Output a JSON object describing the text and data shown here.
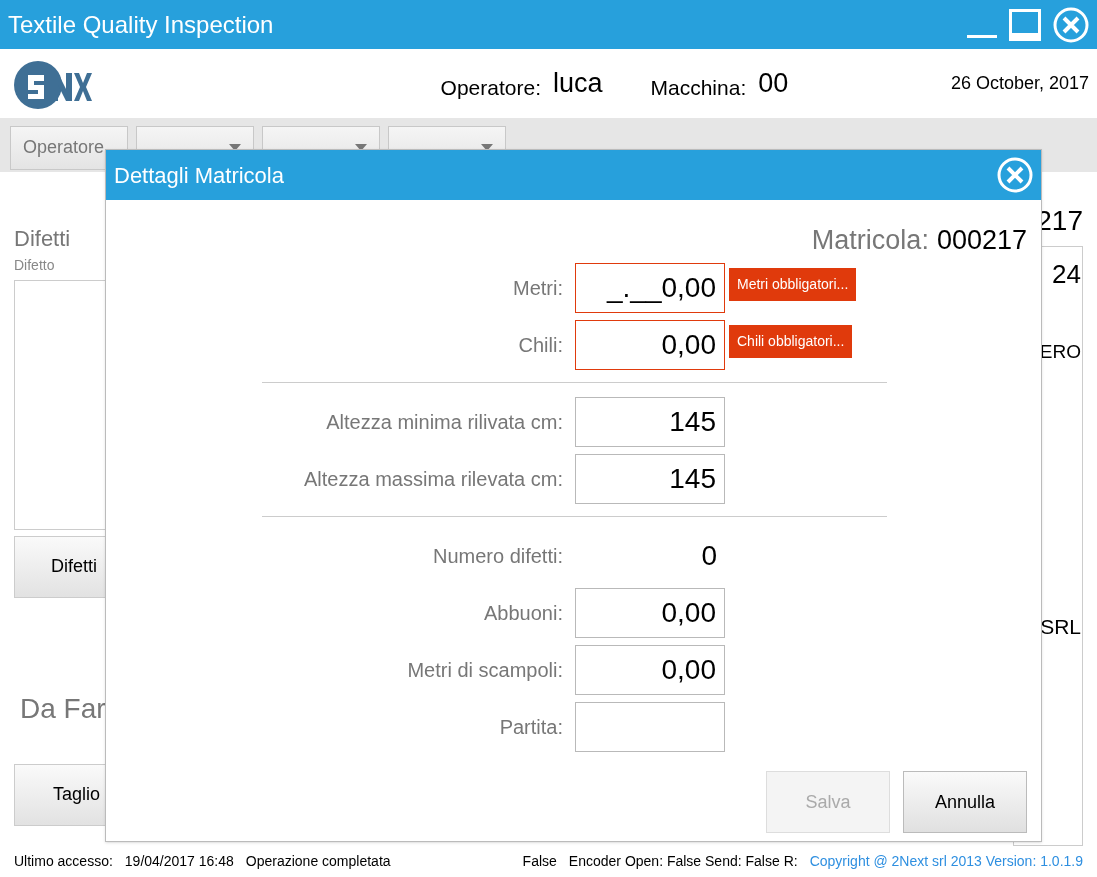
{
  "window": {
    "title": "Textile Quality Inspection"
  },
  "header": {
    "operator_label": "Operatore:",
    "operator": "luca",
    "machine_label": "Macchina:",
    "machine": "00",
    "date": "26 October, 2017"
  },
  "toolbar": {
    "tabs": [
      {
        "label": "Operatore",
        "dropdown": false
      },
      {
        "dropdown": true
      },
      {
        "dropdown": true
      },
      {
        "dropdown": true
      }
    ]
  },
  "background": {
    "title": "Difetti",
    "subtitle": "Difetto",
    "list_button": "Difetti",
    "section": "Da Far",
    "action_button": "Taglio",
    "right_texts": [
      "217",
      "24",
      "ERO",
      "SRL"
    ]
  },
  "dialog": {
    "title": "Dettagli Matricola",
    "matricola_label": "Matricola:",
    "matricola": "000217",
    "groups": [
      [
        {
          "kind": "input",
          "label": "Metri:",
          "value": "_.__0,00",
          "error": "Metri obbligatori..."
        },
        {
          "kind": "input",
          "label": "Chili:",
          "value": "0,00",
          "error": "Chili obbligatori..."
        }
      ],
      [
        {
          "kind": "input",
          "label": "Altezza minima rilivata cm:",
          "value": "145"
        },
        {
          "kind": "input",
          "label": "Altezza massima rilevata cm:",
          "value": "145"
        }
      ],
      [
        {
          "kind": "text",
          "label": "Numero difetti:",
          "value": "0"
        },
        {
          "kind": "input",
          "label": "Abbuoni:",
          "value": "0,00"
        },
        {
          "kind": "input",
          "label": "Metri di scampoli:",
          "value": "0,00"
        },
        {
          "kind": "input",
          "label": "Partita:"
        }
      ]
    ],
    "buttons": [
      {
        "label": "Salva",
        "disabled": true
      },
      {
        "label": "Annulla",
        "disabled": false
      }
    ]
  },
  "status_bar": {
    "last_access_label": "Ultimo accesso:",
    "last_access": "19/04/2017 16:48",
    "message": "Operazione completata",
    "flag": "False",
    "encoder": "Encoder Open: False Send: False R:",
    "copyright": "Copyright @ 2Next srl 2013 Version: 1.0.1.9"
  }
}
